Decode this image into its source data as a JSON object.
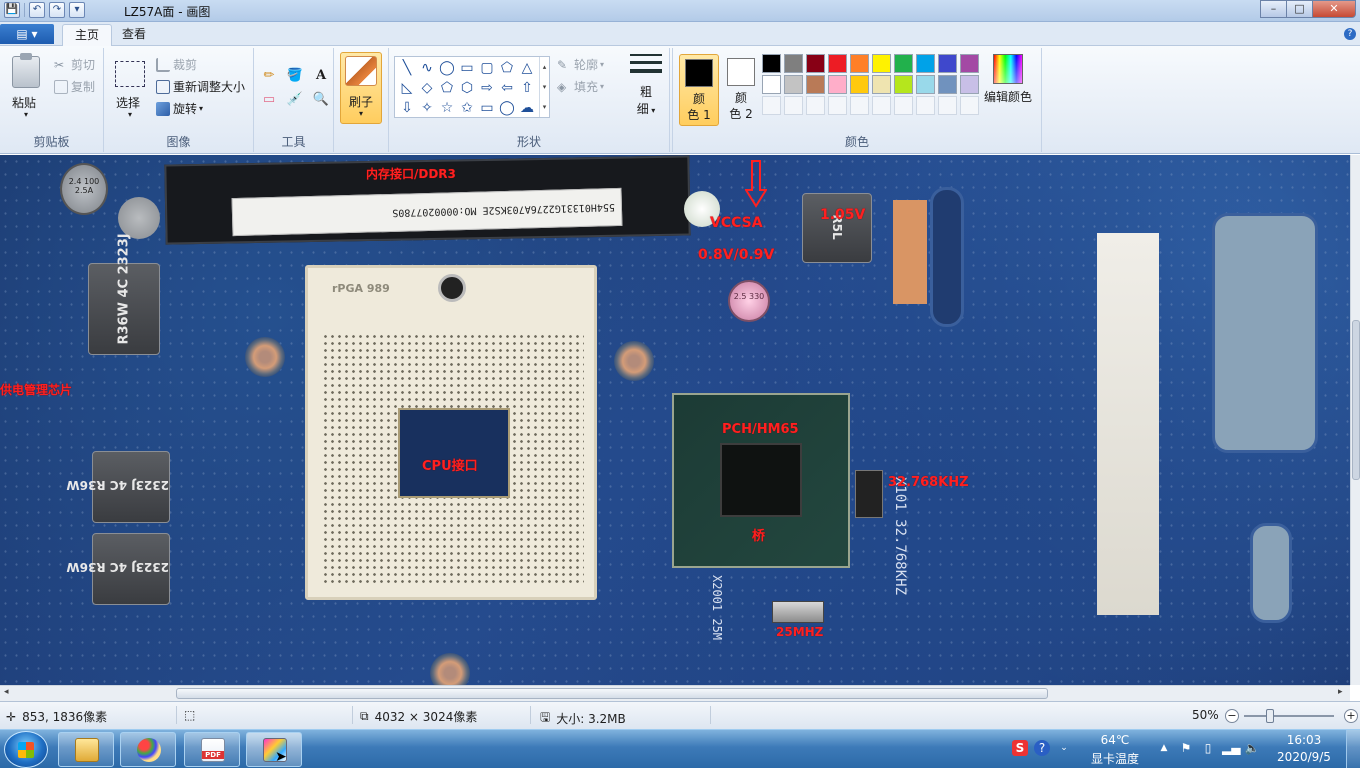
{
  "window": {
    "title": "LZ57A面 - 画图",
    "controls": {
      "minimize": "–",
      "maximize": "□",
      "close": "✕"
    }
  },
  "quick_access": {
    "save": "💾",
    "undo": "↶",
    "redo": "↷",
    "more": "▾"
  },
  "tabs": {
    "file": "▤ ▾",
    "home": "主页",
    "view": "查看"
  },
  "help": "?",
  "ribbon": {
    "clipboard": {
      "paste": "粘贴",
      "cut": "剪切",
      "copy": "复制",
      "label": "剪贴板"
    },
    "image": {
      "select": "选择",
      "crop": "裁剪",
      "resize": "重新调整大小",
      "rotate": "旋转",
      "label": "图像"
    },
    "tools": {
      "label": "工具",
      "items": [
        "✏",
        "🪣",
        "A",
        "▭",
        "💉",
        "🔍"
      ]
    },
    "brushes": {
      "label": "刷子"
    },
    "shapes": {
      "label": "形状",
      "outline": "轮廓",
      "fill": "填充",
      "items": [
        "╲",
        "∿",
        "◯",
        "▭",
        "▢",
        "⬠",
        "△",
        "◺",
        "◇",
        "⬠",
        "⬡",
        "⇨",
        "⇦",
        "⇧",
        "⇩",
        "✧",
        "☆",
        "✩",
        "▭",
        "◯",
        "☁"
      ]
    },
    "size": {
      "label_line1": "粗",
      "label_line2": "细"
    },
    "color1": {
      "line1": "颜",
      "line2": "色 1"
    },
    "color2": {
      "line1": "颜",
      "line2": "色 2"
    },
    "colors_label": "颜色",
    "edit_colors": "编辑颜色",
    "palette": [
      "#000000",
      "#7f7f7f",
      "#880015",
      "#ed1c24",
      "#ff7f27",
      "#fff200",
      "#22b14c",
      "#00a2e8",
      "#3f48cc",
      "#a349a4",
      "#ffffff",
      "#c3c3c3",
      "#b97a57",
      "#ffaec9",
      "#ffc90e",
      "#efe4b0",
      "#b5e61d",
      "#99d9ea",
      "#7092be",
      "#c8bfe7"
    ],
    "selected_color1": "#000000",
    "selected_color2": "#ffffff"
  },
  "annotations": {
    "memory_slot": "内存接口/DDR3",
    "vccsa": "VCCSA",
    "vccsa_voltage": "0.8V/0.9V",
    "v105": "1.05V",
    "power": "供电管理芯片",
    "cpu": "CPU接口",
    "pch": "PCH/HM65",
    "bridge": "桥",
    "xtal32": "32.768KHZ",
    "xtal25": "25MHZ"
  },
  "board_text": {
    "dimm_label": "554H01331G2276A703KS2E  MO:0000207780S",
    "socket_label": "rPGA 989",
    "ind1": "R36W 4C 2323J",
    "ind2": "2323J 4C R36W",
    "ind3": "2323J 4C R36W",
    "ind_top": "R5L",
    "cap1": "2.5 330",
    "cap_tl": "2.4 100 2.5A",
    "pcb_xtal": "X101 32.768KHZ",
    "pcb_x2": "X2001 25M"
  },
  "status": {
    "cursor": "853, 1836像素",
    "dimensions": "4032 × 3024像素",
    "size": "大小: 3.2MB",
    "zoom": "50%",
    "zoom_level": 0.5
  },
  "taskbar": {
    "temp": "64℃",
    "temp_label": "显卡温度",
    "time": "16:03",
    "date": "2020/9/5",
    "ime": "S"
  }
}
